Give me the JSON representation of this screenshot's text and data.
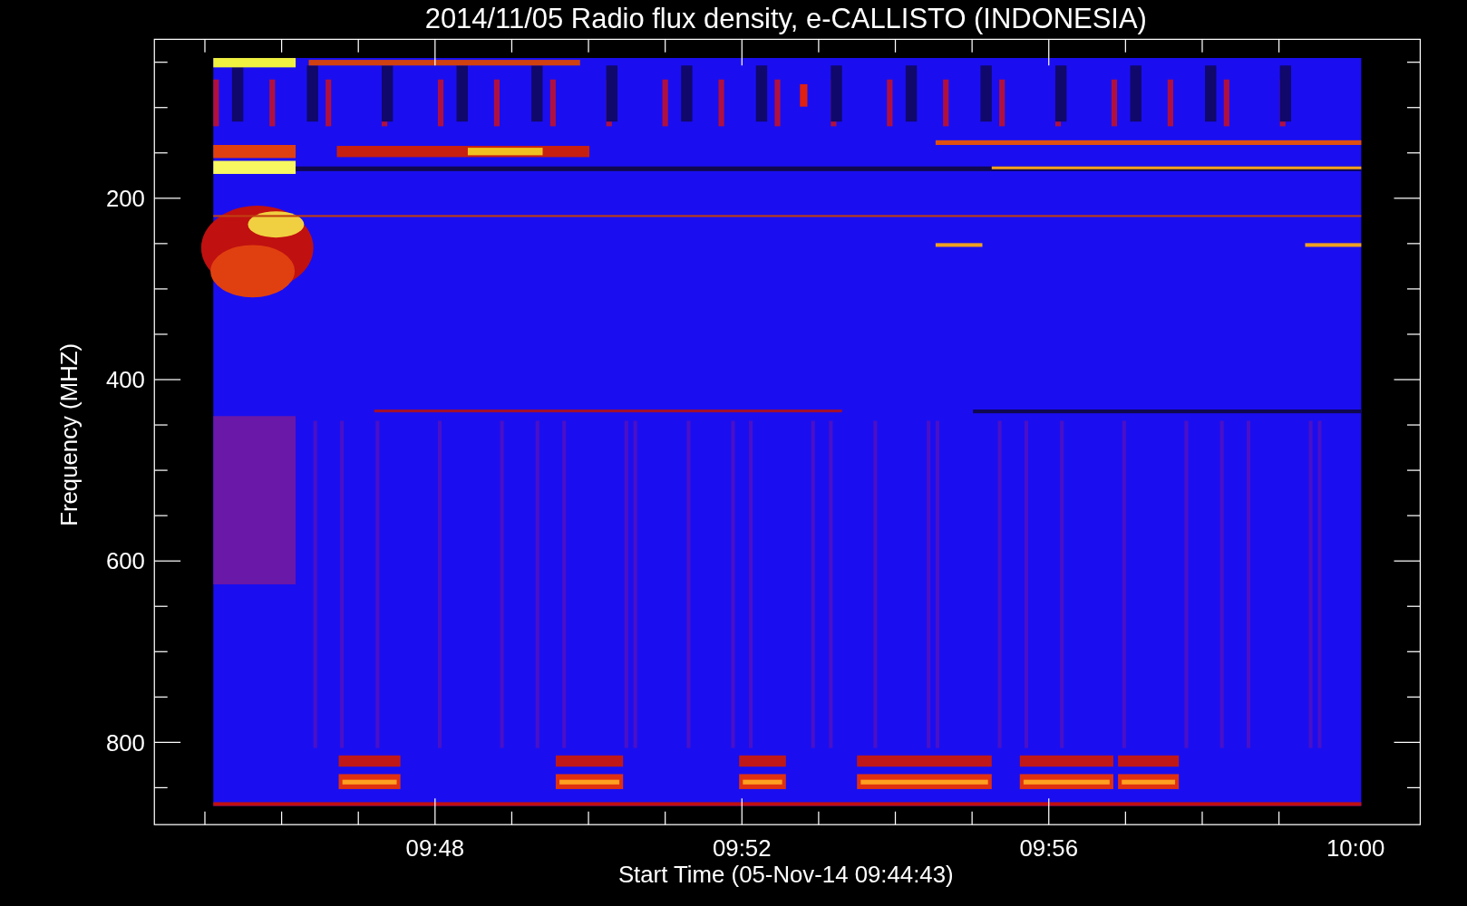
{
  "title": "2014/11/05  Radio flux density, e-CALLISTO (INDONESIA)",
  "y_axis": {
    "label": "Frequency (MHZ)",
    "ticks": [
      "200",
      "400",
      "600",
      "800"
    ]
  },
  "x_axis": {
    "label": "Start Time (05-Nov-14 09:44:43)",
    "ticks": [
      "09:48",
      "09:52",
      "09:56",
      "10:00"
    ]
  }
}
